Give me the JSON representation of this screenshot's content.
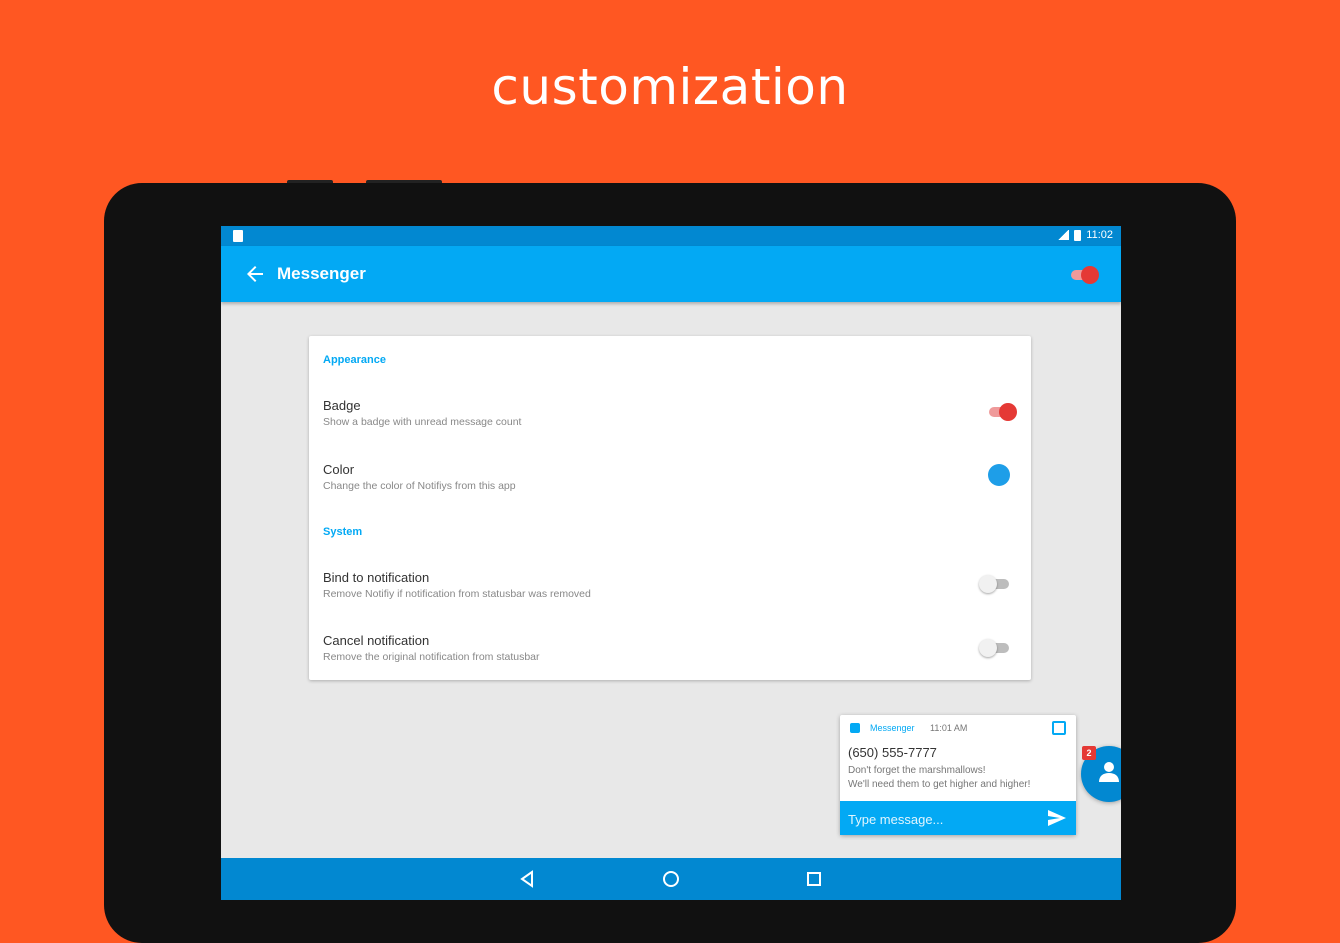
{
  "headline": "customization",
  "statusbar": {
    "time": "11:02"
  },
  "appbar": {
    "title": "Messenger",
    "master_toggle_on": true
  },
  "settings": {
    "sections": [
      {
        "header": "Appearance"
      },
      {
        "header": "System"
      }
    ],
    "rows": [
      {
        "title": "Badge",
        "subtitle": "Show a badge with unread message count",
        "control": "toggle",
        "on": true
      },
      {
        "title": "Color",
        "subtitle": "Change the color of Notifiys from this app",
        "control": "color",
        "value": "#1e9ee8"
      },
      {
        "title": "Bind to notification",
        "subtitle": "Remove Notifiy if notification from statusbar was removed",
        "control": "toggle",
        "on": false
      },
      {
        "title": "Cancel notification",
        "subtitle": "Remove the original notification from statusbar",
        "control": "toggle",
        "on": false
      }
    ]
  },
  "notification": {
    "app": "Messenger",
    "time": "11:01 AM",
    "sender": "(650) 555-7777",
    "message_line1": "Don't forget the marshmallows!",
    "message_line2": "We'll need them to get higher and higher!",
    "reply_placeholder": "Type message..."
  },
  "chathead": {
    "badge_count": "2"
  },
  "colors": {
    "background": "#ff5722",
    "primary": "#03a9f4",
    "primary_dark": "#0288d1",
    "toggle_on": "#e53935"
  }
}
